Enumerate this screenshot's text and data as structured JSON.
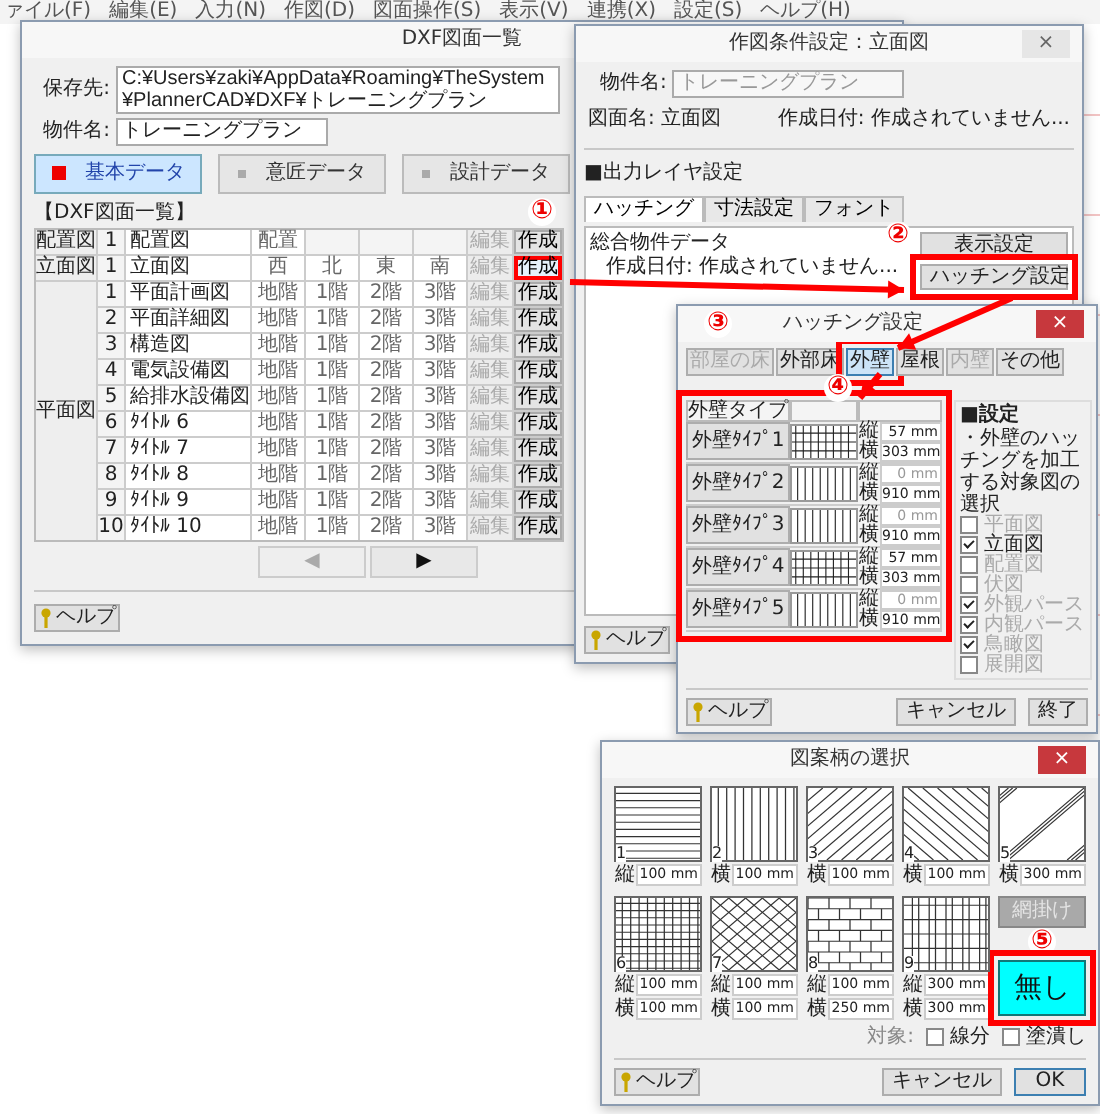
{
  "menu_bar": [
    "ァイル(F)",
    "編集(E)",
    "入力(N)",
    "作図(D)",
    "図面操作(S)",
    "表示(V)",
    "連携(X)",
    "設定(S)",
    "ヘルプ(H)"
  ],
  "dxf_window": {
    "title": "DXF図面一覧",
    "save_label": "保存先:",
    "save_path": "C:¥Users¥zaki¥AppData¥Roaming¥TheSystem¥PlannerCAD¥DXF¥トレーニングプラン",
    "property_label": "物件名:",
    "property_name": "トレーニングプラン",
    "data_tabs": [
      {
        "label": "基本データ",
        "selected": true
      },
      {
        "label": "意匠データ",
        "selected": false
      },
      {
        "label": "設計データ",
        "selected": false
      }
    ],
    "section_label": "【DXF図面一覧】",
    "groups": [
      {
        "label": "配置図",
        "rows": [
          {
            "no": "1",
            "name": "配置図",
            "cells": [
              "配置"
            ],
            "edit": "編集",
            "create": "作成",
            "highlighted": false
          }
        ]
      },
      {
        "label": "立面図",
        "rows": [
          {
            "no": "1",
            "name": "立面図",
            "cells": [
              "西",
              "北",
              "東",
              "南"
            ],
            "edit": "編集",
            "create": "作成",
            "highlighted": true
          }
        ]
      },
      {
        "label": "平面図",
        "rows": [
          {
            "no": "1",
            "name": "平面計画図",
            "cells": [
              "地階",
              "1階",
              "2階",
              "3階"
            ],
            "edit": "編集",
            "create": "作成",
            "highlighted": false
          },
          {
            "no": "2",
            "name": "平面詳細図",
            "cells": [
              "地階",
              "1階",
              "2階",
              "3階"
            ],
            "edit": "編集",
            "create": "作成",
            "highlighted": false
          },
          {
            "no": "3",
            "name": "構造図",
            "cells": [
              "地階",
              "1階",
              "2階",
              "3階"
            ],
            "edit": "編集",
            "create": "作成",
            "highlighted": false
          },
          {
            "no": "4",
            "name": "電気設備図",
            "cells": [
              "地階",
              "1階",
              "2階",
              "3階"
            ],
            "edit": "編集",
            "create": "作成",
            "highlighted": false
          },
          {
            "no": "5",
            "name": "給排水設備図",
            "cells": [
              "地階",
              "1階",
              "2階",
              "3階"
            ],
            "edit": "編集",
            "create": "作成",
            "highlighted": false
          },
          {
            "no": "6",
            "name": "ﾀｲﾄﾙ 6",
            "cells": [
              "地階",
              "1階",
              "2階",
              "3階"
            ],
            "edit": "編集",
            "create": "作成",
            "highlighted": false
          },
          {
            "no": "7",
            "name": "ﾀｲﾄﾙ 7",
            "cells": [
              "地階",
              "1階",
              "2階",
              "3階"
            ],
            "edit": "編集",
            "create": "作成",
            "highlighted": false
          },
          {
            "no": "8",
            "name": "ﾀｲﾄﾙ 8",
            "cells": [
              "地階",
              "1階",
              "2階",
              "3階"
            ],
            "edit": "編集",
            "create": "作成",
            "highlighted": false
          },
          {
            "no": "9",
            "name": "ﾀｲﾄﾙ 9",
            "cells": [
              "地階",
              "1階",
              "2階",
              "3階"
            ],
            "edit": "編集",
            "create": "作成",
            "highlighted": false
          },
          {
            "no": "10",
            "name": "ﾀｲﾄﾙ 10",
            "cells": [
              "地階",
              "1階",
              "2階",
              "3階"
            ],
            "edit": "編集",
            "create": "作成",
            "highlighted": false
          }
        ]
      }
    ],
    "pager": [
      {
        "label": "◀",
        "disabled": true
      },
      {
        "label": "▶",
        "disabled": false
      }
    ],
    "help": "ヘルプ"
  },
  "condition_window": {
    "title": "作図条件設定：立面図",
    "close": "×",
    "property_label": "物件名:",
    "property_name": "トレーニングプラン",
    "drawing_label": "図面名: 立面図",
    "date_label": "作成日付: 作成されていません...",
    "section_label": "■出力レイヤ設定",
    "tabs": [
      {
        "label": "ハッチング",
        "selected": true
      },
      {
        "label": "寸法設定",
        "selected": false
      },
      {
        "label": "フォント",
        "selected": false
      }
    ],
    "group_label": "総合物件データ",
    "group_date": "作成日付: 作成されていません...",
    "buttons": [
      {
        "label": "表示設定",
        "highlighted": false
      },
      {
        "label": "ハッチング設定",
        "highlighted": true
      }
    ],
    "help": "ヘルプ"
  },
  "hatch_window": {
    "title": "ハッチング設定",
    "close": "×",
    "categories": [
      {
        "label": "部屋の床",
        "selected": false,
        "disabled": true
      },
      {
        "label": "外部床",
        "selected": false,
        "disabled": false
      },
      {
        "label": "外壁",
        "selected": true,
        "disabled": false
      },
      {
        "label": "屋根",
        "selected": false,
        "disabled": false
      },
      {
        "label": "内壁",
        "selected": false,
        "disabled": true
      },
      {
        "label": "その他",
        "selected": false,
        "disabled": false
      }
    ],
    "columns": [
      "外壁タイプ"
    ],
    "table_highlighted": true,
    "rows": [
      {
        "label": "外壁ﾀｲﾌﾟ1",
        "kind": "grid",
        "fields": [
          {
            "label": "縦",
            "value": "57 mm",
            "disabled": false
          },
          {
            "label": "横",
            "value": "303 mm",
            "disabled": false
          }
        ]
      },
      {
        "label": "外壁ﾀｲﾌﾟ2",
        "kind": "vertical",
        "fields": [
          {
            "label": "縦",
            "value": "0 mm",
            "disabled": true
          },
          {
            "label": "横",
            "value": "910 mm",
            "disabled": false
          }
        ]
      },
      {
        "label": "外壁ﾀｲﾌﾟ3",
        "kind": "vertical",
        "fields": [
          {
            "label": "縦",
            "value": "0 mm",
            "disabled": true
          },
          {
            "label": "横",
            "value": "910 mm",
            "disabled": false
          }
        ]
      },
      {
        "label": "外壁ﾀｲﾌﾟ4",
        "kind": "grid",
        "fields": [
          {
            "label": "縦",
            "value": "57 mm",
            "disabled": false
          },
          {
            "label": "横",
            "value": "303 mm",
            "disabled": false
          }
        ]
      },
      {
        "label": "外壁ﾀｲﾌﾟ5",
        "kind": "vertical",
        "fields": [
          {
            "label": "縦",
            "value": "0 mm",
            "disabled": true
          },
          {
            "label": "横",
            "value": "910 mm",
            "disabled": false
          }
        ]
      }
    ],
    "settings_label": "■設定",
    "settings_note": "・外壁のハッチングを加工する対象図の選択",
    "targets": [
      {
        "label": "平面図",
        "checked": false,
        "disabled": true
      },
      {
        "label": "立面図",
        "checked": true,
        "disabled": false
      },
      {
        "label": "配置図",
        "checked": false,
        "disabled": true
      },
      {
        "label": "伏図",
        "checked": false,
        "disabled": true
      },
      {
        "label": "外観パース",
        "checked": true,
        "disabled": true
      },
      {
        "label": "内観パース",
        "checked": true,
        "disabled": true
      },
      {
        "label": "鳥瞰図",
        "checked": true,
        "disabled": true
      },
      {
        "label": "展開図",
        "checked": false,
        "disabled": true
      }
    ],
    "help": "ヘルプ",
    "cancel": "キャンセル",
    "finish": "終了"
  },
  "pattern_window": {
    "title": "図案柄の選択",
    "close": "×",
    "patterns": [
      {
        "number": "1",
        "kind": "horizontal",
        "fields": [
          {
            "label": "縦",
            "value": "100 mm"
          }
        ]
      },
      {
        "number": "2",
        "kind": "vertical",
        "fields": [
          {
            "label": "横",
            "value": "100 mm"
          }
        ]
      },
      {
        "number": "3",
        "kind": "diagonal_up",
        "fields": [
          {
            "label": "横",
            "value": "100 mm"
          }
        ]
      },
      {
        "number": "4",
        "kind": "diagonal_down",
        "fields": [
          {
            "label": "横",
            "value": "100 mm"
          }
        ]
      },
      {
        "number": "5",
        "kind": "double_diagonal",
        "fields": [
          {
            "label": "横",
            "value": "300 mm"
          }
        ]
      },
      {
        "number": "6",
        "kind": "grid",
        "fields": [
          {
            "label": "縦",
            "value": "100 mm"
          },
          {
            "label": "横",
            "value": "100 mm"
          }
        ]
      },
      {
        "number": "7",
        "kind": "lattice",
        "fields": [
          {
            "label": "縦",
            "value": "100 mm"
          },
          {
            "label": "横",
            "value": "100 mm"
          }
        ]
      },
      {
        "number": "8",
        "kind": "brick",
        "fields": [
          {
            "label": "縦",
            "value": "100 mm"
          },
          {
            "label": "横",
            "value": "250 mm"
          }
        ]
      },
      {
        "number": "9",
        "kind": "tile",
        "fields": [
          {
            "label": "縦",
            "value": "300 mm"
          },
          {
            "label": "横",
            "value": "300 mm"
          }
        ]
      }
    ],
    "mode_buttons": [
      {
        "label": "網掛け",
        "selected": false,
        "disabled": true
      },
      {
        "label": "無し",
        "selected": true,
        "disabled": false
      }
    ],
    "target_label": "対象:",
    "options": [
      {
        "label": "線分",
        "checked": false
      },
      {
        "label": "塗潰し",
        "checked": false
      }
    ],
    "help": "ヘルプ",
    "cancel": "キャンセル",
    "ok": "OK"
  },
  "annotations": [
    {
      "label": "①"
    },
    {
      "label": "②"
    },
    {
      "label": "③"
    },
    {
      "label": "④"
    },
    {
      "label": "⑤"
    }
  ]
}
